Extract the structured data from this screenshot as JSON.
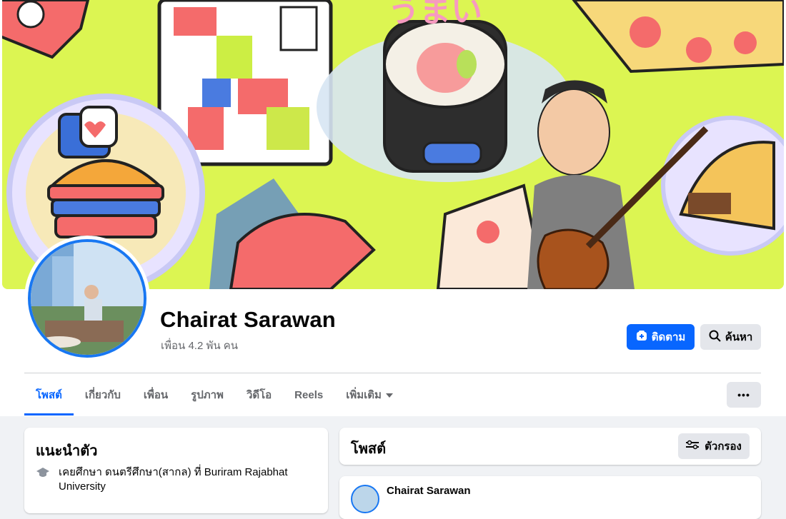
{
  "profile": {
    "name": "Chairat Sarawan",
    "friends": "เพื่อน 4.2 พัน คน"
  },
  "actions": {
    "follow_label": "ติดตาม",
    "search_label": "ค้นหา",
    "more_label": "•••"
  },
  "tabs": [
    {
      "label": "โพสต์",
      "active": true
    },
    {
      "label": "เกี่ยวกับ"
    },
    {
      "label": "เพื่อน"
    },
    {
      "label": "รูปภาพ"
    },
    {
      "label": "วิดีโอ"
    },
    {
      "label": "Reels"
    },
    {
      "label": "เพิ่มเติม"
    }
  ],
  "intro": {
    "title": "แนะนำตัว",
    "education": "เคยศึกษา ดนตรีศึกษา(สากล) ที่ Buriram Rajabhat University"
  },
  "posts": {
    "title": "โพสต์",
    "filter_label": "ตัวกรอง",
    "first_author": "Chairat Sarawan"
  },
  "colors": {
    "accent": "#0866ff",
    "cover_bg": "#dcf552",
    "avatar_ring": "#1877f2"
  },
  "icons": [
    "follow-icon",
    "search-icon",
    "chevron-down-icon",
    "more-icon",
    "graduation-cap-icon",
    "filter-icon"
  ]
}
